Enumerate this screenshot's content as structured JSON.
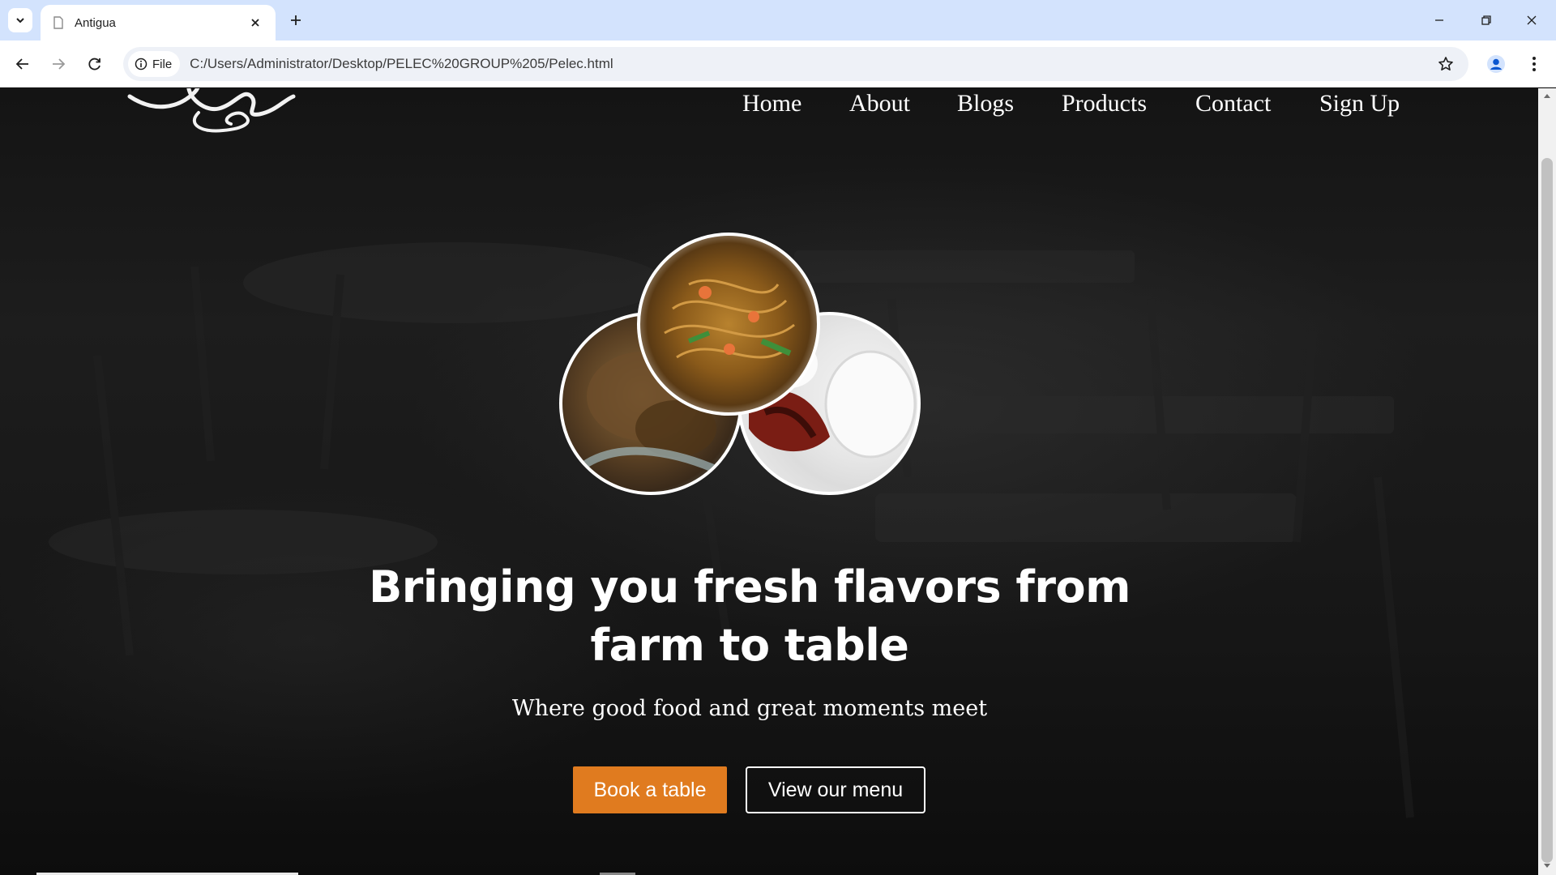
{
  "browser": {
    "tab_title": "Antigua",
    "url_chip": "File",
    "url": "C:/Users/Administrator/Desktop/PELEC%20GROUP%205/Pelec.html"
  },
  "page": {
    "nav": [
      "Home",
      "About",
      "Blogs",
      "Products",
      "Contact",
      "Sign Up"
    ],
    "headline_line1": "Bringing you fresh flavors from",
    "headline_line2": "farm to table",
    "subheading": "Where good food and great moments meet",
    "book_button": "Book a table",
    "menu_button": "View our menu",
    "accent_color": "#e07b1f"
  },
  "icons": {
    "tab_search": "chevron-down-icon",
    "favicon": "page-icon",
    "tab_close": "close-icon",
    "new_tab": "plus-icon",
    "back": "arrow-left-icon",
    "forward": "arrow-right-icon",
    "reload": "reload-icon",
    "site_info": "info-icon",
    "bookmark": "star-icon",
    "profile": "person-icon",
    "menu": "kebab-icon"
  }
}
